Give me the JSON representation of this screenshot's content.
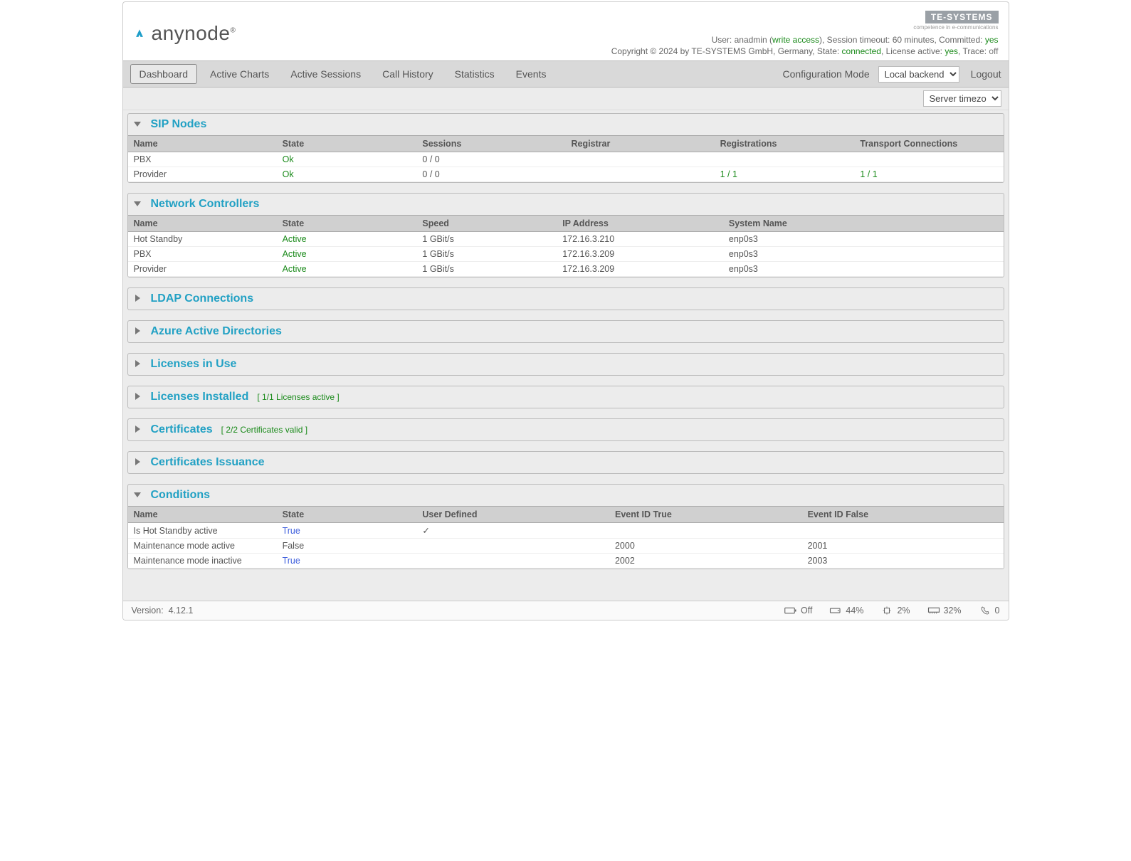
{
  "brand": "anynode",
  "vendor": {
    "name": "TE-SYSTEMS",
    "tagline": "competence in e-communications"
  },
  "status": {
    "userLabel": "User:",
    "user": "anadmin",
    "access": "write access",
    "sessLabel": ", Session timeout:",
    "sessVal": "60 minutes",
    "commLabel": ", Committed:",
    "commVal": "yes"
  },
  "copyright": {
    "prefix": "Copyright © 2024 by TE-SYSTEMS GmbH, Germany, State:",
    "state": "connected",
    "licLabel": ", License active:",
    "lic": "yes",
    "traceLabel": ", Trace:",
    "trace": "off"
  },
  "nav": {
    "tabs": [
      "Dashboard",
      "Active Charts",
      "Active Sessions",
      "Call History",
      "Statistics",
      "Events"
    ],
    "active": 0,
    "configLabel": "Configuration Mode",
    "configVal": "Local backend",
    "logout": "Logout"
  },
  "tzSelect": "Server timezone",
  "panels": {
    "sip": {
      "title": "SIP Nodes",
      "cols": [
        "Name",
        "State",
        "Sessions",
        "Registrar",
        "Registrations",
        "Transport Connections"
      ],
      "rows": [
        {
          "name": "PBX",
          "state": "Ok",
          "sessions": "0 / 0",
          "registrar": "",
          "regs": "",
          "trans": ""
        },
        {
          "name": "Provider",
          "state": "Ok",
          "sessions": "0 / 0",
          "registrar": "",
          "regs": "1 / 1",
          "trans": "1 / 1"
        }
      ]
    },
    "net": {
      "title": "Network Controllers",
      "cols": [
        "Name",
        "State",
        "Speed",
        "IP Address",
        "System Name"
      ],
      "rows": [
        {
          "name": "Hot Standby",
          "state": "Active",
          "speed": "1 GBit/s",
          "ip": "172.16.3.210",
          "sys": "enp0s3"
        },
        {
          "name": "PBX",
          "state": "Active",
          "speed": "1 GBit/s",
          "ip": "172.16.3.209",
          "sys": "enp0s3"
        },
        {
          "name": "Provider",
          "state": "Active",
          "speed": "1 GBit/s",
          "ip": "172.16.3.209",
          "sys": "enp0s3"
        }
      ]
    },
    "ldap": {
      "title": "LDAP Connections"
    },
    "azure": {
      "title": "Azure Active Directories"
    },
    "licUse": {
      "title": "Licenses in Use"
    },
    "licInst": {
      "title": "Licenses Installed",
      "sub": "[ 1/1 Licenses active ]"
    },
    "certs": {
      "title": "Certificates",
      "sub": "[ 2/2 Certificates valid ]"
    },
    "certIss": {
      "title": "Certificates Issuance"
    },
    "cond": {
      "title": "Conditions",
      "cols": [
        "Name",
        "State",
        "User Defined",
        "Event ID True",
        "Event ID False"
      ],
      "rows": [
        {
          "name": "Is Hot Standby active",
          "state": "True",
          "stateCls": "true",
          "ud": "✓",
          "et": "",
          "ef": ""
        },
        {
          "name": "Maintenance mode active",
          "state": "False",
          "stateCls": "",
          "ud": "",
          "et": "2000",
          "ef": "2001"
        },
        {
          "name": "Maintenance mode inactive",
          "state": "True",
          "stateCls": "true",
          "ud": "",
          "et": "2002",
          "ef": "2003"
        }
      ]
    }
  },
  "footer": {
    "versionLabel": "Version:",
    "version": "4.12.1",
    "off": "Off",
    "disk": "44%",
    "cpu": "2%",
    "mem": "32%",
    "calls": "0"
  }
}
